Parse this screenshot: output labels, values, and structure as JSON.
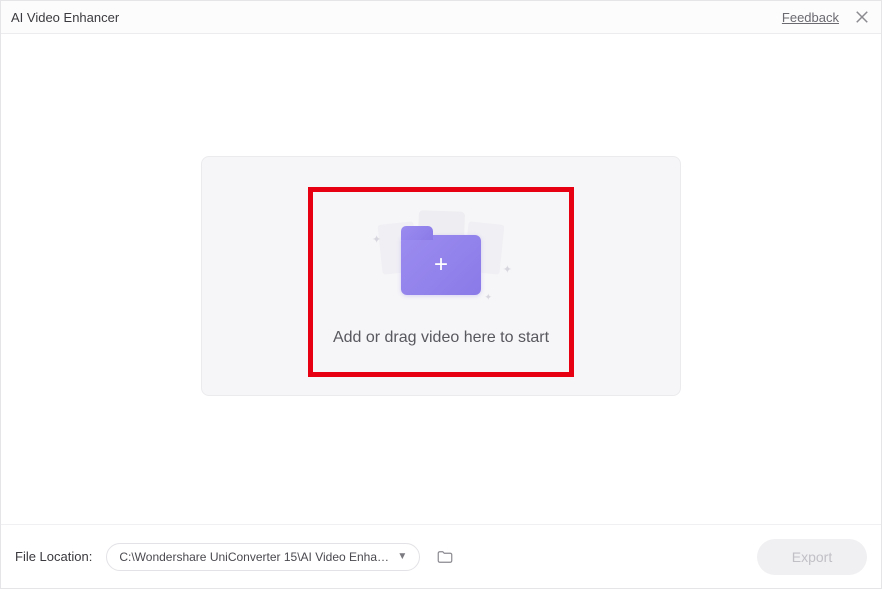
{
  "header": {
    "title": "AI Video Enhancer",
    "feedback_label": "Feedback"
  },
  "dropzone": {
    "instruction": "Add or drag video here to start"
  },
  "footer": {
    "file_location_label": "File Location:",
    "path": "C:\\Wondershare UniConverter 15\\AI Video Enhance",
    "export_label": "Export"
  }
}
